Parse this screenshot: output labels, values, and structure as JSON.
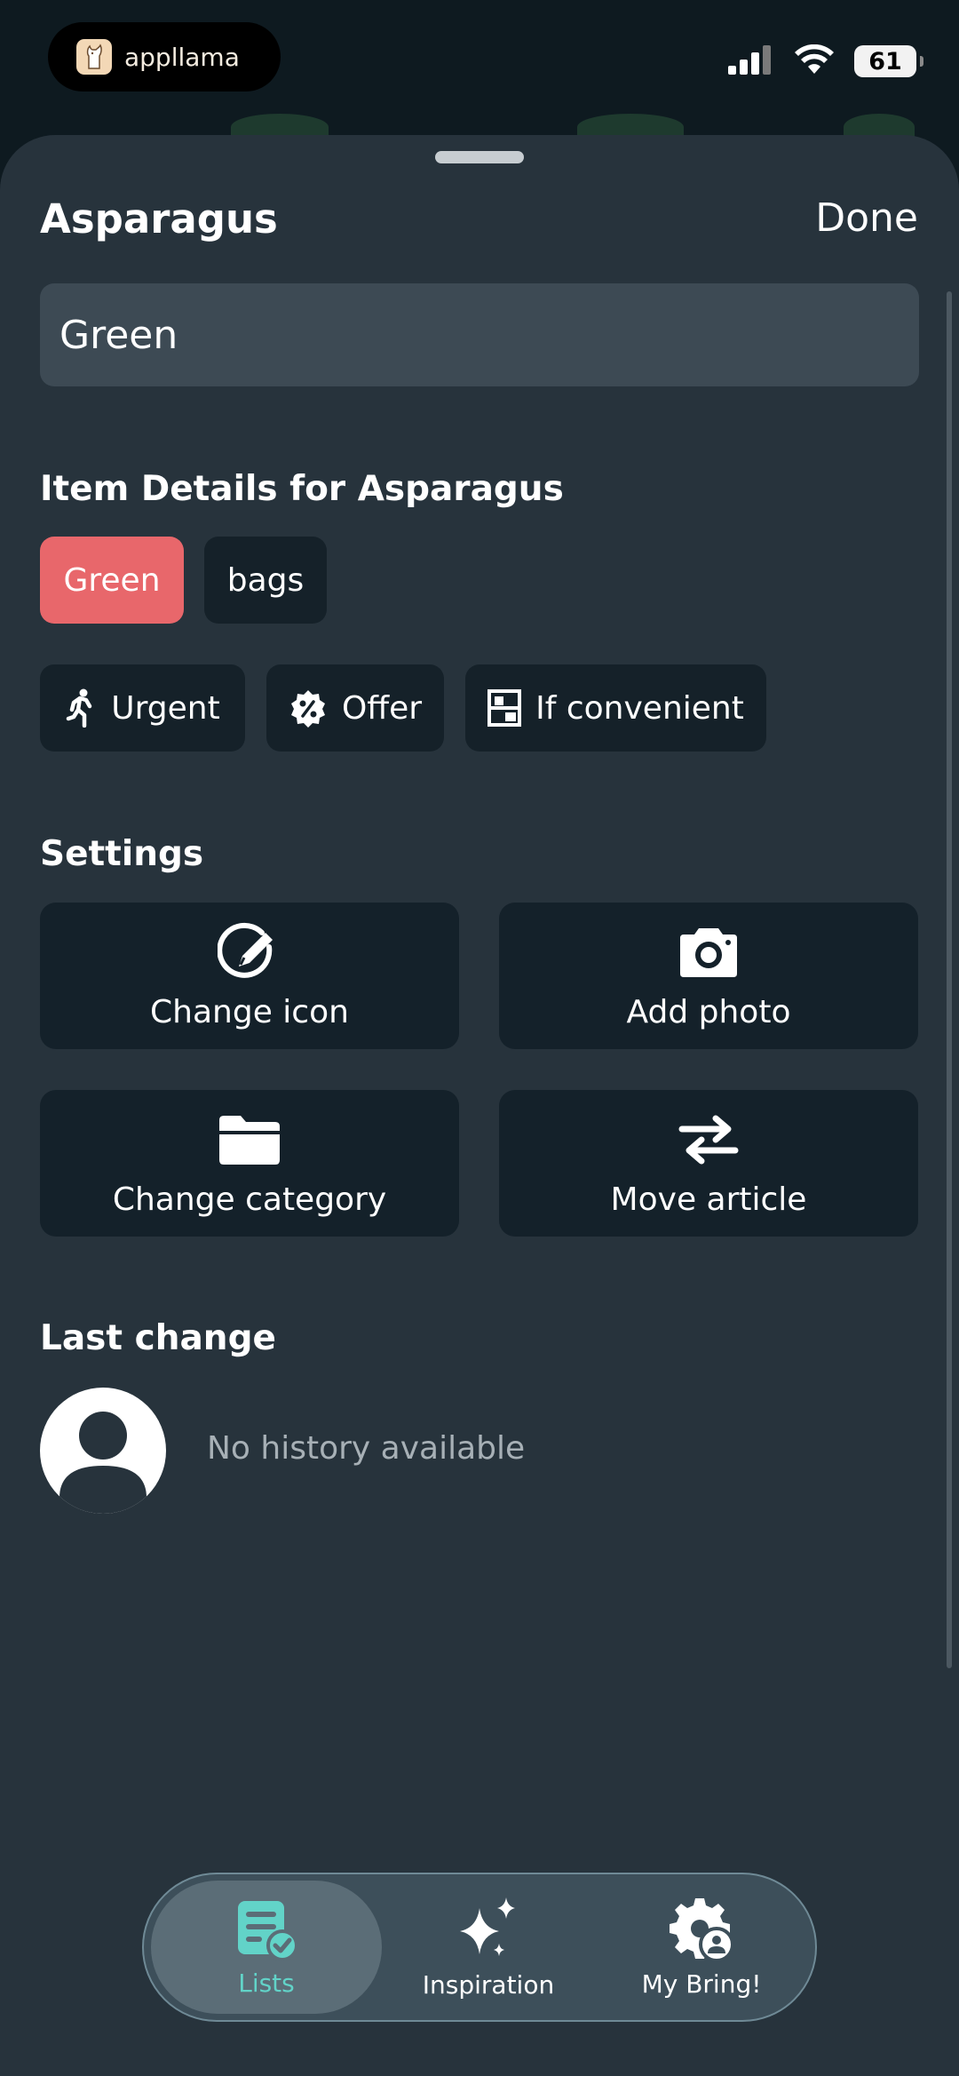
{
  "status_bar": {
    "app_name": "appllama",
    "battery": "61"
  },
  "sheet": {
    "title": "Asparagus",
    "done_label": "Done",
    "spec_value": "Green",
    "details_title": "Item Details for Asparagus",
    "spec_chips": [
      "Green",
      "bags"
    ],
    "tags": [
      {
        "label": "Urgent",
        "icon": "running-person-icon"
      },
      {
        "label": "Offer",
        "icon": "percent-badge-icon"
      },
      {
        "label": "If convenient",
        "icon": "shelf-icon"
      }
    ],
    "settings_title": "Settings",
    "settings": [
      {
        "label": "Change icon",
        "icon": "edit-icon"
      },
      {
        "label": "Add photo",
        "icon": "camera-icon"
      },
      {
        "label": "Change category",
        "icon": "folder-icon"
      },
      {
        "label": "Move article",
        "icon": "swap-arrows-icon"
      }
    ],
    "last_change_title": "Last change",
    "history_text": "No history available"
  },
  "tabbar": {
    "tabs": [
      {
        "label": "Lists",
        "icon": "list-check-icon",
        "selected": true
      },
      {
        "label": "Inspiration",
        "icon": "sparkles-icon",
        "selected": false
      },
      {
        "label": "My Bring!",
        "icon": "gear-user-icon",
        "selected": false
      }
    ]
  },
  "colors": {
    "sheet_bg": "#27333c",
    "tile_bg": "#14212a",
    "accent_chip": "#e8676b",
    "tab_accent": "#62d3c8"
  }
}
